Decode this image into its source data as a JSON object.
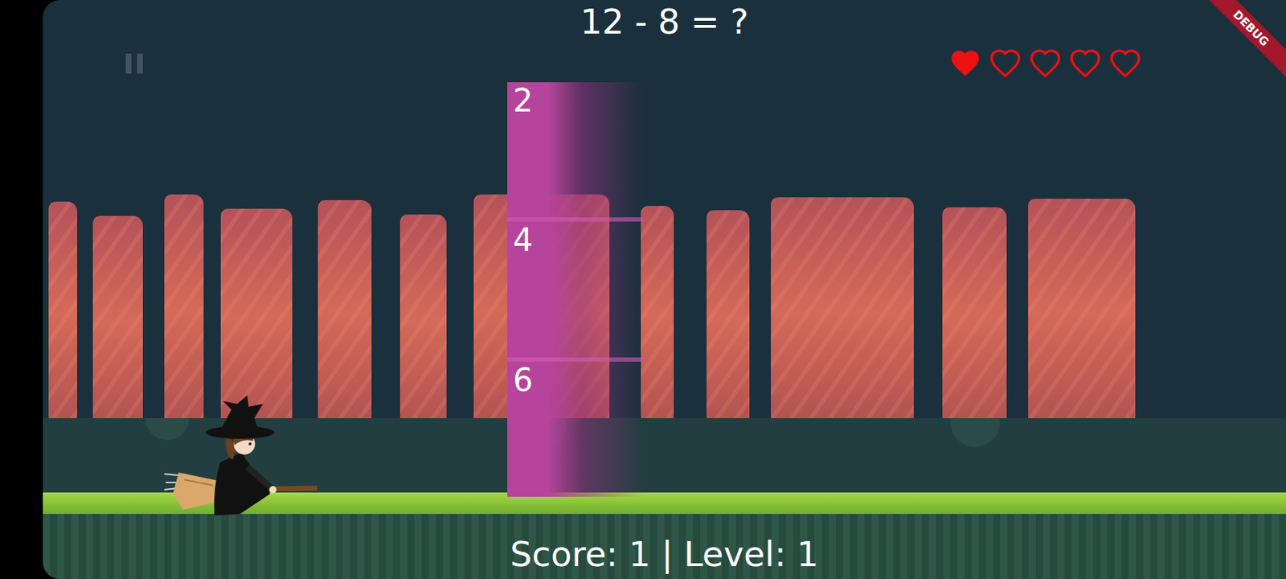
{
  "question": "12 - 8 = ?",
  "lives": [
    {
      "filled": true
    },
    {
      "filled": false
    },
    {
      "filled": false
    },
    {
      "filled": false
    },
    {
      "filled": false
    }
  ],
  "answers": [
    "2",
    "4",
    "6"
  ],
  "status": "Score: 1 | Level: 1",
  "debug_banner": "DEBUG"
}
